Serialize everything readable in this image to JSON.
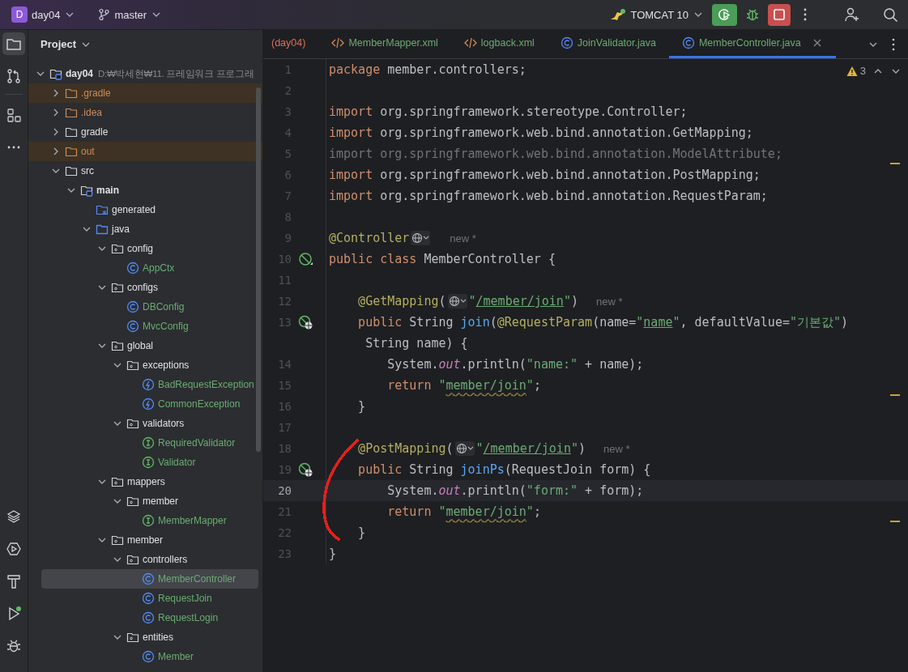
{
  "title_bar": {
    "project": {
      "avatar": "D",
      "name": "day04"
    },
    "branch": "master",
    "run_config": "TOMCAT 10"
  },
  "tool_strip": {
    "top": [
      {
        "kind": "project",
        "selected": true
      },
      {
        "kind": "commit",
        "selected": false
      },
      {
        "kind": "structure",
        "selected": false
      },
      {
        "kind": "more",
        "selected": false
      }
    ],
    "bottom": [
      {
        "kind": "layers",
        "selected": false
      },
      {
        "kind": "services",
        "selected": false
      },
      {
        "kind": "build",
        "selected": false
      },
      {
        "kind": "run",
        "selected": false
      },
      {
        "kind": "debug",
        "selected": false
      }
    ]
  },
  "project_panel": {
    "title": "Project",
    "tree": [
      {
        "name": "day04",
        "path": "D:₩박세현₩11. 프레임워크 프로그래",
        "kind": "module",
        "expanded": true,
        "selected": false,
        "children": [
          {
            "name": ".gradle",
            "kind": "folder",
            "expanded": false,
            "ignored": true,
            "excluded": true,
            "selected": false
          },
          {
            "name": ".idea",
            "kind": "folder",
            "expanded": false,
            "ignored": true,
            "excluded": false,
            "selected": false
          },
          {
            "name": "gradle",
            "kind": "folder",
            "expanded": false,
            "ignored": false,
            "excluded": false,
            "selected": false
          },
          {
            "name": "out",
            "kind": "folder",
            "expanded": false,
            "ignored": true,
            "excluded": true,
            "selected": false
          },
          {
            "name": "src",
            "kind": "folder",
            "expanded": true,
            "selected": false,
            "children": [
              {
                "name": "main",
                "kind": "module",
                "expanded": true,
                "selected": false,
                "children": [
                  {
                    "name": "generated",
                    "kind": "generated",
                    "selected": false
                  },
                  {
                    "name": "java",
                    "kind": "source",
                    "expanded": true,
                    "selected": false,
                    "children": [
                      {
                        "name": "config",
                        "kind": "package",
                        "expanded": true,
                        "selected": false,
                        "children": [
                          {
                            "name": "AppCtx",
                            "kind": "class",
                            "added": true,
                            "selected": false
                          }
                        ]
                      },
                      {
                        "name": "configs",
                        "kind": "package",
                        "expanded": true,
                        "selected": false,
                        "children": [
                          {
                            "name": "DBConfig",
                            "kind": "class",
                            "added": true,
                            "selected": false
                          },
                          {
                            "name": "MvcConfig",
                            "kind": "class",
                            "added": true,
                            "selected": false
                          }
                        ]
                      },
                      {
                        "name": "global",
                        "kind": "package",
                        "expanded": true,
                        "selected": false,
                        "children": [
                          {
                            "name": "exceptions",
                            "kind": "package",
                            "expanded": true,
                            "selected": false,
                            "children": [
                              {
                                "name": "BadRequestException",
                                "kind": "exception",
                                "added": true,
                                "selected": false
                              },
                              {
                                "name": "CommonException",
                                "kind": "exception",
                                "added": true,
                                "selected": false
                              }
                            ]
                          },
                          {
                            "name": "validators",
                            "kind": "package",
                            "expanded": true,
                            "selected": false,
                            "children": [
                              {
                                "name": "RequiredValidator",
                                "kind": "interface",
                                "added": true,
                                "selected": false
                              },
                              {
                                "name": "Validator",
                                "kind": "interface",
                                "added": true,
                                "selected": false
                              }
                            ]
                          }
                        ]
                      },
                      {
                        "name": "mappers",
                        "kind": "package",
                        "expanded": true,
                        "selected": false,
                        "children": [
                          {
                            "name": "member",
                            "kind": "package",
                            "expanded": true,
                            "selected": false,
                            "children": [
                              {
                                "name": "MemberMapper",
                                "kind": "interface",
                                "added": true,
                                "selected": false
                              }
                            ]
                          }
                        ]
                      },
                      {
                        "name": "member",
                        "kind": "package",
                        "expanded": true,
                        "selected": false,
                        "children": [
                          {
                            "name": "controllers",
                            "kind": "package",
                            "expanded": true,
                            "selected": false,
                            "children": [
                              {
                                "name": "MemberController",
                                "kind": "class",
                                "added": true,
                                "selected": true
                              },
                              {
                                "name": "RequestJoin",
                                "kind": "class",
                                "added": true,
                                "selected": false
                              },
                              {
                                "name": "RequestLogin",
                                "kind": "class",
                                "added": true,
                                "selected": false
                              }
                            ]
                          },
                          {
                            "name": "entities",
                            "kind": "package",
                            "expanded": true,
                            "selected": false,
                            "children": [
                              {
                                "name": "Member",
                                "kind": "class",
                                "added": true,
                                "selected": false
                              }
                            ]
                          }
                        ]
                      }
                    ]
                  }
                ]
              }
            ]
          }
        ]
      }
    ]
  },
  "editor": {
    "tabs": [
      {
        "label": "(day04)",
        "kind": "partial",
        "problem": true,
        "selected": false
      },
      {
        "label": "MemberMapper.xml",
        "kind": "xml",
        "added": true,
        "selected": false
      },
      {
        "label": "logback.xml",
        "kind": "xml",
        "added": true,
        "selected": false
      },
      {
        "label": "JoinValidator.java",
        "kind": "class",
        "added": true,
        "selected": false
      },
      {
        "label": "MemberController.java",
        "kind": "class",
        "added": true,
        "selected": true
      }
    ],
    "warnings": "3",
    "lines": [
      {
        "number": "1",
        "tokens": [
          {
            "kind": "kw",
            "text": "package"
          },
          {
            "kind": "plain",
            "text": " member.controllers;"
          }
        ]
      },
      {
        "number": "2"
      },
      {
        "number": "3",
        "tokens": [
          {
            "kind": "kw",
            "text": "import"
          },
          {
            "kind": "plain",
            "text": " org.springframework.stereotype.Controller;"
          }
        ]
      },
      {
        "number": "4",
        "tokens": [
          {
            "kind": "kw",
            "text": "import"
          },
          {
            "kind": "plain",
            "text": " org.springframework.web.bind.annotation.GetMapping;"
          }
        ]
      },
      {
        "number": "5",
        "warning": true,
        "tokens": [
          {
            "kind": "unused",
            "text": "import org.springframework.web.bind.annotation.ModelAttribute;"
          }
        ]
      },
      {
        "number": "6",
        "tokens": [
          {
            "kind": "kw",
            "text": "import"
          },
          {
            "kind": "plain",
            "text": " org.springframework.web.bind.annotation.PostMapping;"
          }
        ]
      },
      {
        "number": "7",
        "tokens": [
          {
            "kind": "kw",
            "text": "import"
          },
          {
            "kind": "plain",
            "text": " org.springframework.web.bind.annotation.RequestParam;"
          }
        ]
      },
      {
        "number": "8"
      },
      {
        "number": "9",
        "tokens": [
          {
            "kind": "ann",
            "text": "@Controller"
          },
          {
            "kind": "inlay"
          },
          {
            "kind": "hint",
            "text": "new *"
          }
        ]
      },
      {
        "number": "10",
        "gutter": {
          "kind": "bean"
        },
        "tokens": [
          {
            "kind": "kw",
            "text": "public class "
          },
          {
            "kind": "plain",
            "text": "MemberController {"
          }
        ]
      },
      {
        "number": "11"
      },
      {
        "number": "12",
        "tokens": [
          {
            "kind": "ann",
            "text": "    @GetMapping"
          },
          {
            "kind": "plain",
            "text": "("
          },
          {
            "kind": "inlay"
          },
          {
            "kind": "str",
            "text": "\""
          },
          {
            "kind": "url",
            "text": "/member/join"
          },
          {
            "kind": "str",
            "text": "\""
          },
          {
            "kind": "plain",
            "text": ")"
          },
          {
            "kind": "hint",
            "text": "new *"
          }
        ]
      },
      {
        "number": "13",
        "gutter": {
          "kind": "web"
        },
        "tokens": [
          {
            "kind": "kw",
            "text": "    public "
          },
          {
            "kind": "plain",
            "text": "String "
          },
          {
            "kind": "fn",
            "text": "join"
          },
          {
            "kind": "plain",
            "text": "("
          },
          {
            "kind": "ann",
            "text": "@RequestParam"
          },
          {
            "kind": "plain",
            "text": "(name="
          },
          {
            "kind": "str",
            "text": "\""
          },
          {
            "kind": "url",
            "text": "name"
          },
          {
            "kind": "str",
            "text": "\""
          },
          {
            "kind": "plain",
            "text": ", defaultValue="
          },
          {
            "kind": "str",
            "text": "\"기본값\""
          },
          {
            "kind": "plain",
            "text": ")"
          }
        ]
      },
      {
        "tokens": [
          {
            "kind": "plain",
            "text": "     String name) {"
          }
        ]
      },
      {
        "number": "14",
        "tokens": [
          {
            "kind": "plain",
            "text": "        System."
          },
          {
            "kind": "field",
            "text": "out"
          },
          {
            "kind": "plain",
            "text": ".println("
          },
          {
            "kind": "str",
            "text": "\"name:\""
          },
          {
            "kind": "plain",
            "text": " + name);"
          }
        ]
      },
      {
        "number": "15",
        "warning": true,
        "tokens": [
          {
            "kind": "kw",
            "text": "        return "
          },
          {
            "kind": "str",
            "text": "\""
          },
          {
            "kind": "typo",
            "text": "member/join"
          },
          {
            "kind": "str",
            "text": "\""
          },
          {
            "kind": "plain",
            "text": ";"
          }
        ]
      },
      {
        "number": "16",
        "tokens": [
          {
            "kind": "plain",
            "text": "    }"
          }
        ]
      },
      {
        "number": "17"
      },
      {
        "number": "18",
        "tokens": [
          {
            "kind": "ann",
            "text": "    @PostMapping"
          },
          {
            "kind": "plain",
            "text": "("
          },
          {
            "kind": "inlay"
          },
          {
            "kind": "str",
            "text": "\""
          },
          {
            "kind": "url",
            "text": "/member/join"
          },
          {
            "kind": "str",
            "text": "\""
          },
          {
            "kind": "plain",
            "text": ")"
          },
          {
            "kind": "hint",
            "text": "new *"
          }
        ]
      },
      {
        "number": "19",
        "gutter": {
          "kind": "web"
        },
        "tokens": [
          {
            "kind": "kw",
            "text": "    public "
          },
          {
            "kind": "plain",
            "text": "String "
          },
          {
            "kind": "fn",
            "text": "joinPs"
          },
          {
            "kind": "plain",
            "text": "(RequestJoin form) {"
          }
        ]
      },
      {
        "number": "20",
        "current": true,
        "tokens": [
          {
            "kind": "plain",
            "text": "        System."
          },
          {
            "kind": "field",
            "text": "out"
          },
          {
            "kind": "plain",
            "text": ".println("
          },
          {
            "kind": "str",
            "text": "\"form:\""
          },
          {
            "kind": "plain",
            "text": " + form);"
          }
        ]
      },
      {
        "number": "21",
        "warning": true,
        "tokens": [
          {
            "kind": "kw",
            "text": "        return "
          },
          {
            "kind": "str",
            "text": "\""
          },
          {
            "kind": "typo",
            "text": "member/join"
          },
          {
            "kind": "str",
            "text": "\""
          },
          {
            "kind": "plain",
            "text": ";"
          }
        ]
      },
      {
        "number": "22",
        "tokens": [
          {
            "kind": "plain",
            "text": "    }"
          }
        ]
      },
      {
        "number": "23",
        "tokens": [
          {
            "kind": "plain",
            "text": "}"
          }
        ]
      }
    ],
    "annotations": [
      {
        "kind": "freehand",
        "color": "#e3211c"
      }
    ]
  }
}
